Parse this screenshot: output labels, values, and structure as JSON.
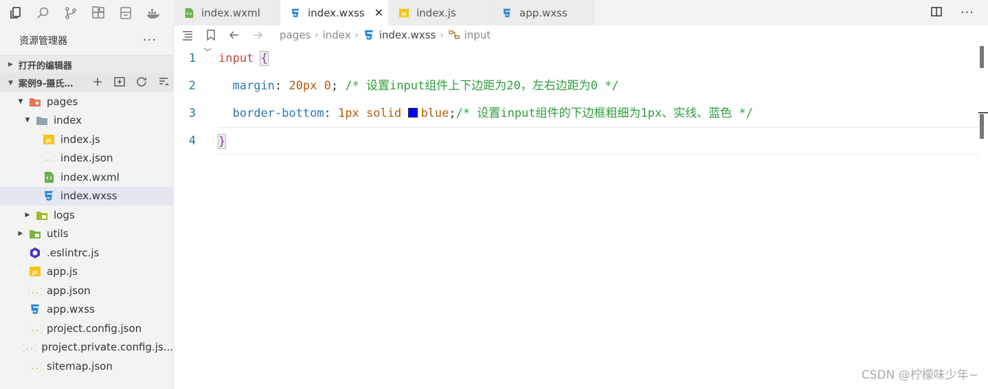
{
  "sidebar": {
    "header_title": "资源管理器",
    "more_label": "···",
    "open_editors_label": "打开的编辑器",
    "project_name": "案例9-摄氏…",
    "tree": [
      {
        "label": "pages",
        "kind": "folder-pages",
        "depth": 1,
        "expanded": true
      },
      {
        "label": "index",
        "kind": "folder",
        "depth": 2,
        "expanded": true
      },
      {
        "label": "index.js",
        "kind": "js",
        "depth": 3
      },
      {
        "label": "index.json",
        "kind": "json",
        "depth": 3
      },
      {
        "label": "index.wxml",
        "kind": "wxml",
        "depth": 3
      },
      {
        "label": "index.wxss",
        "kind": "wxss",
        "depth": 3,
        "selected": true
      },
      {
        "label": "logs",
        "kind": "folder-logs",
        "depth": 2,
        "expanded": false
      },
      {
        "label": "utils",
        "kind": "folder-utils",
        "depth": 1,
        "expanded": false
      },
      {
        "label": ".eslintrc.js",
        "kind": "eslint",
        "depth": 1
      },
      {
        "label": "app.js",
        "kind": "js",
        "depth": 1
      },
      {
        "label": "app.json",
        "kind": "json",
        "depth": 1
      },
      {
        "label": "app.wxss",
        "kind": "wxss",
        "depth": 1
      },
      {
        "label": "project.config.json",
        "kind": "json",
        "depth": 1
      },
      {
        "label": "project.private.config.js...",
        "kind": "json",
        "depth": 1
      },
      {
        "label": "sitemap.json",
        "kind": "json",
        "depth": 1
      }
    ]
  },
  "tabs": [
    {
      "label": "index.wxml",
      "kind": "wxml",
      "active": false
    },
    {
      "label": "index.wxss",
      "kind": "wxss",
      "active": true,
      "close": "✕"
    },
    {
      "label": "index.js",
      "kind": "js",
      "active": false
    },
    {
      "label": "app.wxss",
      "kind": "wxss",
      "active": false
    }
  ],
  "breadcrumb": {
    "items": [
      "pages",
      "index",
      "index.wxss",
      "input"
    ]
  },
  "editor": {
    "line_numbers": [
      "1",
      "2",
      "3",
      "4"
    ],
    "line1": {
      "selector": "input",
      "brace": "{"
    },
    "line2": {
      "prop": "margin",
      "colon": ": ",
      "v1": "20px",
      "v2": "0",
      "semi": ";",
      "comment": " /* 设置input组件上下边距为20，左右边距为0 */"
    },
    "line3": {
      "prop": "border-bottom",
      "colon": ": ",
      "v1": "1px",
      "v2": "solid",
      "color": "blue",
      "semi": ";",
      "comment": "/* 设置input组件的下边框粗细为1px、实线、蓝色 */"
    },
    "line4": {
      "brace": "}"
    }
  },
  "watermark": "CSDN @柠檬味少年~",
  "colors": {
    "accent": "#2a77b8",
    "swatch": "#0000ff"
  }
}
